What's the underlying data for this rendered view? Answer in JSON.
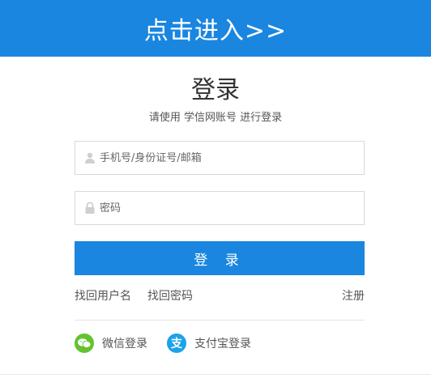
{
  "banner": {
    "label": "点击进入>>"
  },
  "login": {
    "title": "登录",
    "subtitle": "请使用 学信网账号 进行登录",
    "account": {
      "placeholder": "手机号/身份证号/邮箱",
      "value": "",
      "icon": "user-icon"
    },
    "password": {
      "placeholder": "密码",
      "value": "",
      "icon": "lock-icon"
    },
    "submit_label": "登 录"
  },
  "links": {
    "find_username": "找回用户名",
    "find_password": "找回密码",
    "register": "注册"
  },
  "social": {
    "wechat": {
      "label": "微信登录",
      "icon": "wechat-icon"
    },
    "alipay": {
      "label": "支付宝登录",
      "icon": "alipay-icon",
      "glyph": "支"
    }
  },
  "colors": {
    "primary": "#1a86e0",
    "wechat": "#62c32f",
    "alipay": "#1aa3e8"
  }
}
